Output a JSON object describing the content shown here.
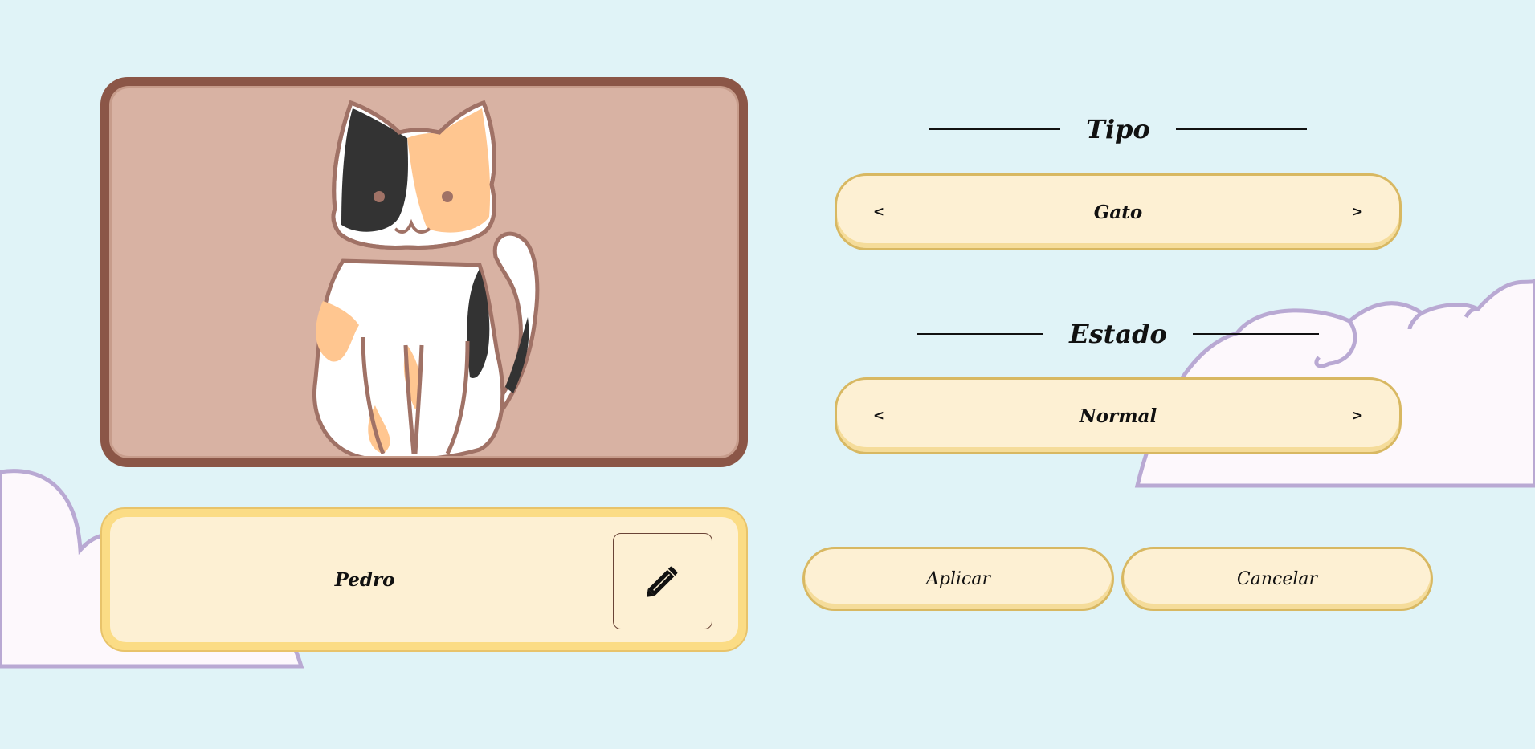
{
  "pet": {
    "name": "Pedro",
    "image": "calico-cat"
  },
  "type_section": {
    "heading": "Tipo",
    "prev_label": "<",
    "value": "Gato",
    "next_label": ">"
  },
  "state_section": {
    "heading": "Estado",
    "prev_label": "<",
    "value": "Normal",
    "next_label": ">"
  },
  "actions": {
    "apply_label": "Aplicar",
    "cancel_label": "Cancelar"
  },
  "icons": {
    "edit": "pencil-icon"
  },
  "colors": {
    "background": "#e0f3f7",
    "frame": "#8b5647",
    "frame_inner": "#d8b2a3",
    "button_fill": "#fdf0d3",
    "button_border": "#d8b862",
    "cloud_fill": "#fdf8fc",
    "cloud_outline": "#b9a9d3"
  }
}
